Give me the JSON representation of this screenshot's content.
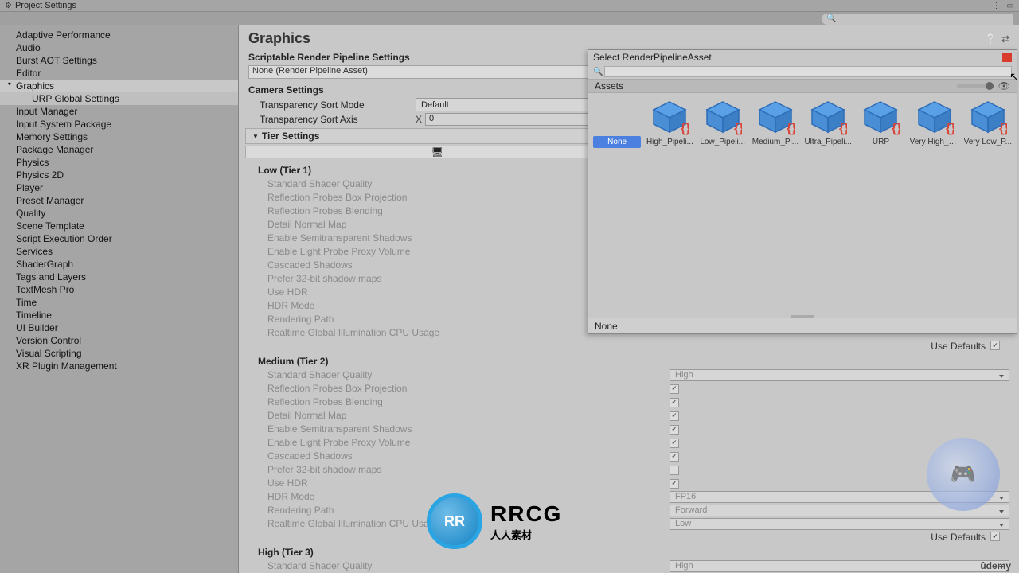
{
  "window": {
    "title": "Project Settings",
    "search_placeholder": ""
  },
  "sidebar": {
    "items": [
      "Adaptive Performance",
      "Audio",
      "Burst AOT Settings",
      "Editor",
      "Graphics",
      "URP Global Settings",
      "Input Manager",
      "Input System Package",
      "Memory Settings",
      "Package Manager",
      "Physics",
      "Physics 2D",
      "Player",
      "Preset Manager",
      "Quality",
      "Scene Template",
      "Script Execution Order",
      "Services",
      "ShaderGraph",
      "Tags and Layers",
      "TextMesh Pro",
      "Time",
      "Timeline",
      "UI Builder",
      "Version Control",
      "Visual Scripting",
      "XR Plugin Management"
    ],
    "selected": 4,
    "child_of": {
      "5": 4
    }
  },
  "main": {
    "title": "Graphics",
    "srp_label": "Scriptable Render Pipeline Settings",
    "srp_value": "None (Render Pipeline Asset)",
    "camera_label": "Camera Settings",
    "tsort_label": "Transparency Sort Mode",
    "tsort_value": "Default",
    "tsortaxis_label": "Transparency Sort Axis",
    "tsortaxis_x": "X",
    "tsortaxis_xv": "0",
    "tier_label": "Tier Settings",
    "tiers": [
      {
        "name": "Low (Tier 1)",
        "use_defaults": null
      },
      {
        "name": "Medium (Tier 2)",
        "use_defaults": true,
        "props": [
          {
            "label": "Standard Shader Quality",
            "type": "dropdown",
            "value": "High"
          },
          {
            "label": "Reflection Probes Box Projection",
            "type": "check",
            "value": true
          },
          {
            "label": "Reflection Probes Blending",
            "type": "check",
            "value": true
          },
          {
            "label": "Detail Normal Map",
            "type": "check",
            "value": true
          },
          {
            "label": "Enable Semitransparent Shadows",
            "type": "check",
            "value": true
          },
          {
            "label": "Enable Light Probe Proxy Volume",
            "type": "check",
            "value": true
          },
          {
            "label": "Cascaded Shadows",
            "type": "check",
            "value": true
          },
          {
            "label": "Prefer 32-bit shadow maps",
            "type": "check",
            "value": false
          },
          {
            "label": "Use HDR",
            "type": "check",
            "value": true
          },
          {
            "label": "HDR Mode",
            "type": "dropdown",
            "value": "FP16"
          },
          {
            "label": "Rendering Path",
            "type": "dropdown",
            "value": "Forward"
          },
          {
            "label": "Realtime Global Illumination CPU Usage",
            "type": "dropdown",
            "value": "Low"
          }
        ]
      },
      {
        "name": "High (Tier 3)",
        "use_defaults": true,
        "props": [
          {
            "label": "Standard Shader Quality",
            "type": "dropdown",
            "value": "High"
          }
        ]
      }
    ],
    "tier1_props": [
      "Standard Shader Quality",
      "Reflection Probes Box Projection",
      "Reflection Probes Blending",
      "Detail Normal Map",
      "Enable Semitransparent Shadows",
      "Enable Light Probe Proxy Volume",
      "Cascaded Shadows",
      "Prefer 32-bit shadow maps",
      "Use HDR",
      "HDR Mode",
      "Rendering Path",
      "Realtime Global Illumination CPU Usage"
    ],
    "use_defaults_label": "Use Defaults"
  },
  "popup": {
    "title": "Select RenderPipelineAsset",
    "assets_label": "Assets",
    "footer": "None",
    "selected": 0,
    "items": [
      {
        "label": "None",
        "icon": "none"
      },
      {
        "label": "High_Pipeli...",
        "icon": "cube"
      },
      {
        "label": "Low_Pipeli...",
        "icon": "cube"
      },
      {
        "label": "Medium_Pi...",
        "icon": "cube"
      },
      {
        "label": "Ultra_Pipeli...",
        "icon": "cube"
      },
      {
        "label": "URP",
        "icon": "cube"
      },
      {
        "label": "Very High_P...",
        "icon": "cube"
      },
      {
        "label": "Very Low_P...",
        "icon": "cube"
      }
    ]
  },
  "branding": {
    "rrcg_big": "RRCG",
    "rrcg_small": "人人素材",
    "udemy": "ûdemy"
  }
}
